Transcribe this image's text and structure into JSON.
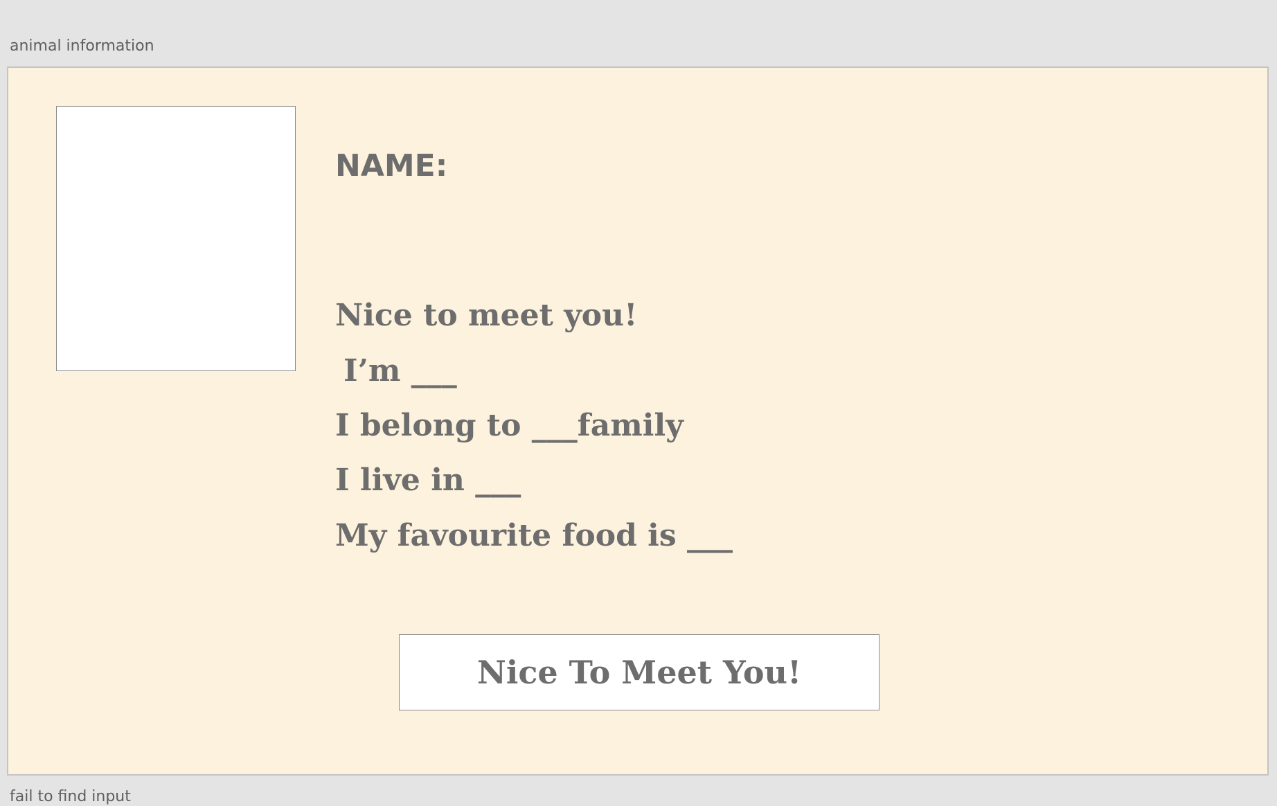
{
  "window": {
    "title": "animal information"
  },
  "card": {
    "name_label": "NAME:",
    "lines": [
      "Nice to meet you!",
      "I’m ___",
      "I belong to ___family",
      "I live in ___",
      "My favourite food is ___"
    ],
    "button_label": "Nice To Meet You!"
  },
  "status": {
    "text": "fail to find input"
  },
  "colors": {
    "page_background": "#e4e4e4",
    "card_background": "#fdf2dd",
    "text": "#6d6d6d",
    "box_border": "#8a8a8a"
  }
}
